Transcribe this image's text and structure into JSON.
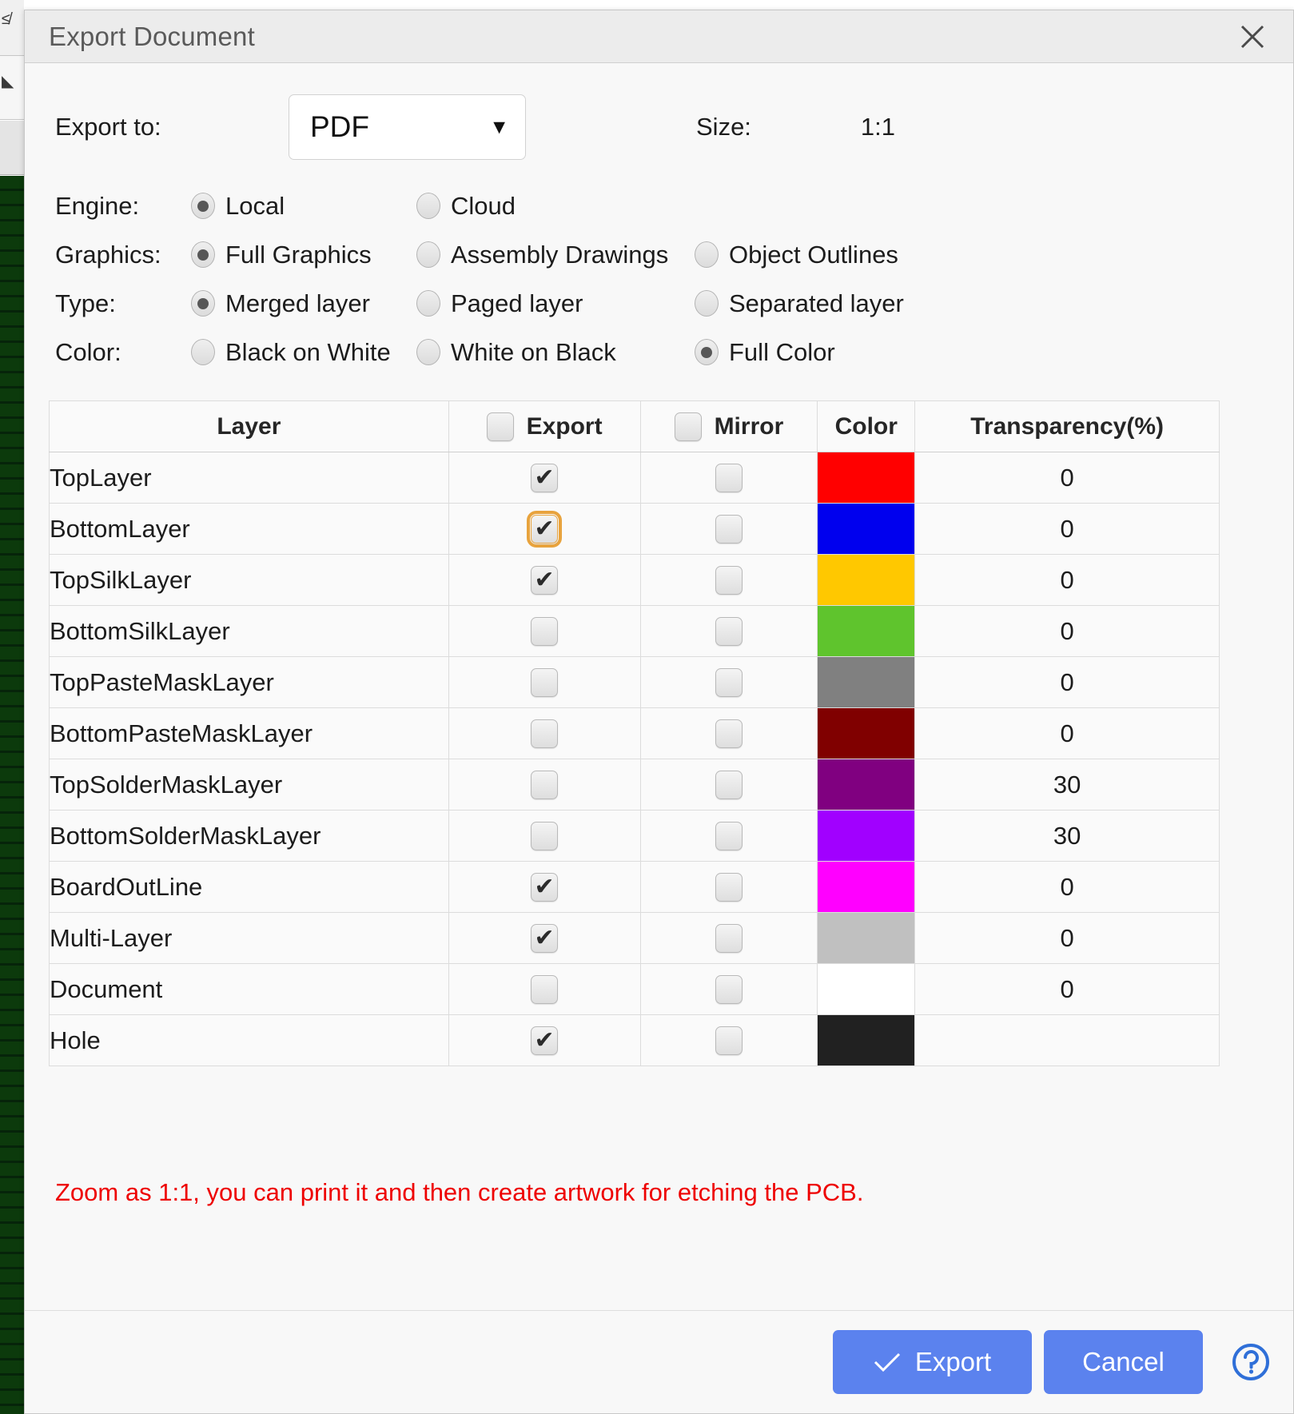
{
  "window": {
    "title": "Export Document",
    "close_icon": "close-icon"
  },
  "form": {
    "export_to_label": "Export to:",
    "format_value": "PDF",
    "format_caret": "▼",
    "size_label": "Size:",
    "size_value": "1:1",
    "groups": [
      {
        "label": "Engine:",
        "options": [
          {
            "label": "Local",
            "selected": true
          },
          {
            "label": "Cloud",
            "selected": false
          }
        ]
      },
      {
        "label": "Graphics:",
        "options": [
          {
            "label": "Full Graphics",
            "selected": true
          },
          {
            "label": "Assembly Drawings",
            "selected": false
          },
          {
            "label": "Object Outlines",
            "selected": false
          }
        ]
      },
      {
        "label": "Type:",
        "options": [
          {
            "label": "Merged layer",
            "selected": true
          },
          {
            "label": "Paged layer",
            "selected": false
          },
          {
            "label": "Separated layer",
            "selected": false
          }
        ]
      },
      {
        "label": "Color:",
        "options": [
          {
            "label": "Black on White",
            "selected": false
          },
          {
            "label": "White on Black",
            "selected": false
          },
          {
            "label": "Full Color",
            "selected": true
          }
        ]
      }
    ]
  },
  "table": {
    "headers": {
      "layer": "Layer",
      "export": "Export",
      "mirror": "Mirror",
      "color": "Color",
      "transparency": "Transparency(%)"
    },
    "header_export_checked": false,
    "header_mirror_checked": false,
    "check_mark": "✔",
    "rows": [
      {
        "layer": "TopLayer",
        "export": true,
        "mirror": false,
        "color": "#ff0000",
        "transparency": "0",
        "focused": false
      },
      {
        "layer": "BottomLayer",
        "export": true,
        "mirror": false,
        "color": "#0000ee",
        "transparency": "0",
        "focused": true
      },
      {
        "layer": "TopSilkLayer",
        "export": true,
        "mirror": false,
        "color": "#ffc800",
        "transparency": "0",
        "focused": false
      },
      {
        "layer": "BottomSilkLayer",
        "export": false,
        "mirror": false,
        "color": "#5fc42d",
        "transparency": "0",
        "focused": false
      },
      {
        "layer": "TopPasteMaskLayer",
        "export": false,
        "mirror": false,
        "color": "#808080",
        "transparency": "0",
        "focused": false
      },
      {
        "layer": "BottomPasteMaskLayer",
        "export": false,
        "mirror": false,
        "color": "#800000",
        "transparency": "0",
        "focused": false
      },
      {
        "layer": "TopSolderMaskLayer",
        "export": false,
        "mirror": false,
        "color": "#800080",
        "transparency": "30",
        "focused": false
      },
      {
        "layer": "BottomSolderMaskLayer",
        "export": false,
        "mirror": false,
        "color": "#a100ff",
        "transparency": "30",
        "focused": false
      },
      {
        "layer": "BoardOutLine",
        "export": true,
        "mirror": false,
        "color": "#ff00ff",
        "transparency": "0",
        "focused": false
      },
      {
        "layer": "Multi-Layer",
        "export": true,
        "mirror": false,
        "color": "#c0c0c0",
        "transparency": "0",
        "focused": false
      },
      {
        "layer": "Document",
        "export": false,
        "mirror": false,
        "color": "#ffffff",
        "transparency": "0",
        "focused": false
      },
      {
        "layer": "Hole",
        "export": true,
        "mirror": false,
        "color": "#212121",
        "transparency": "",
        "focused": false
      }
    ]
  },
  "note": "Zoom as 1:1, you can print it and then create artwork for etching the PCB.",
  "footer": {
    "export_label": "Export",
    "cancel_label": "Cancel",
    "export_check_icon": "check-icon",
    "help_icon": "help-circle-icon"
  },
  "colors": {
    "accent": "#5b82ee",
    "note": "#ee0000",
    "focus_ring": "#e8a33d"
  }
}
